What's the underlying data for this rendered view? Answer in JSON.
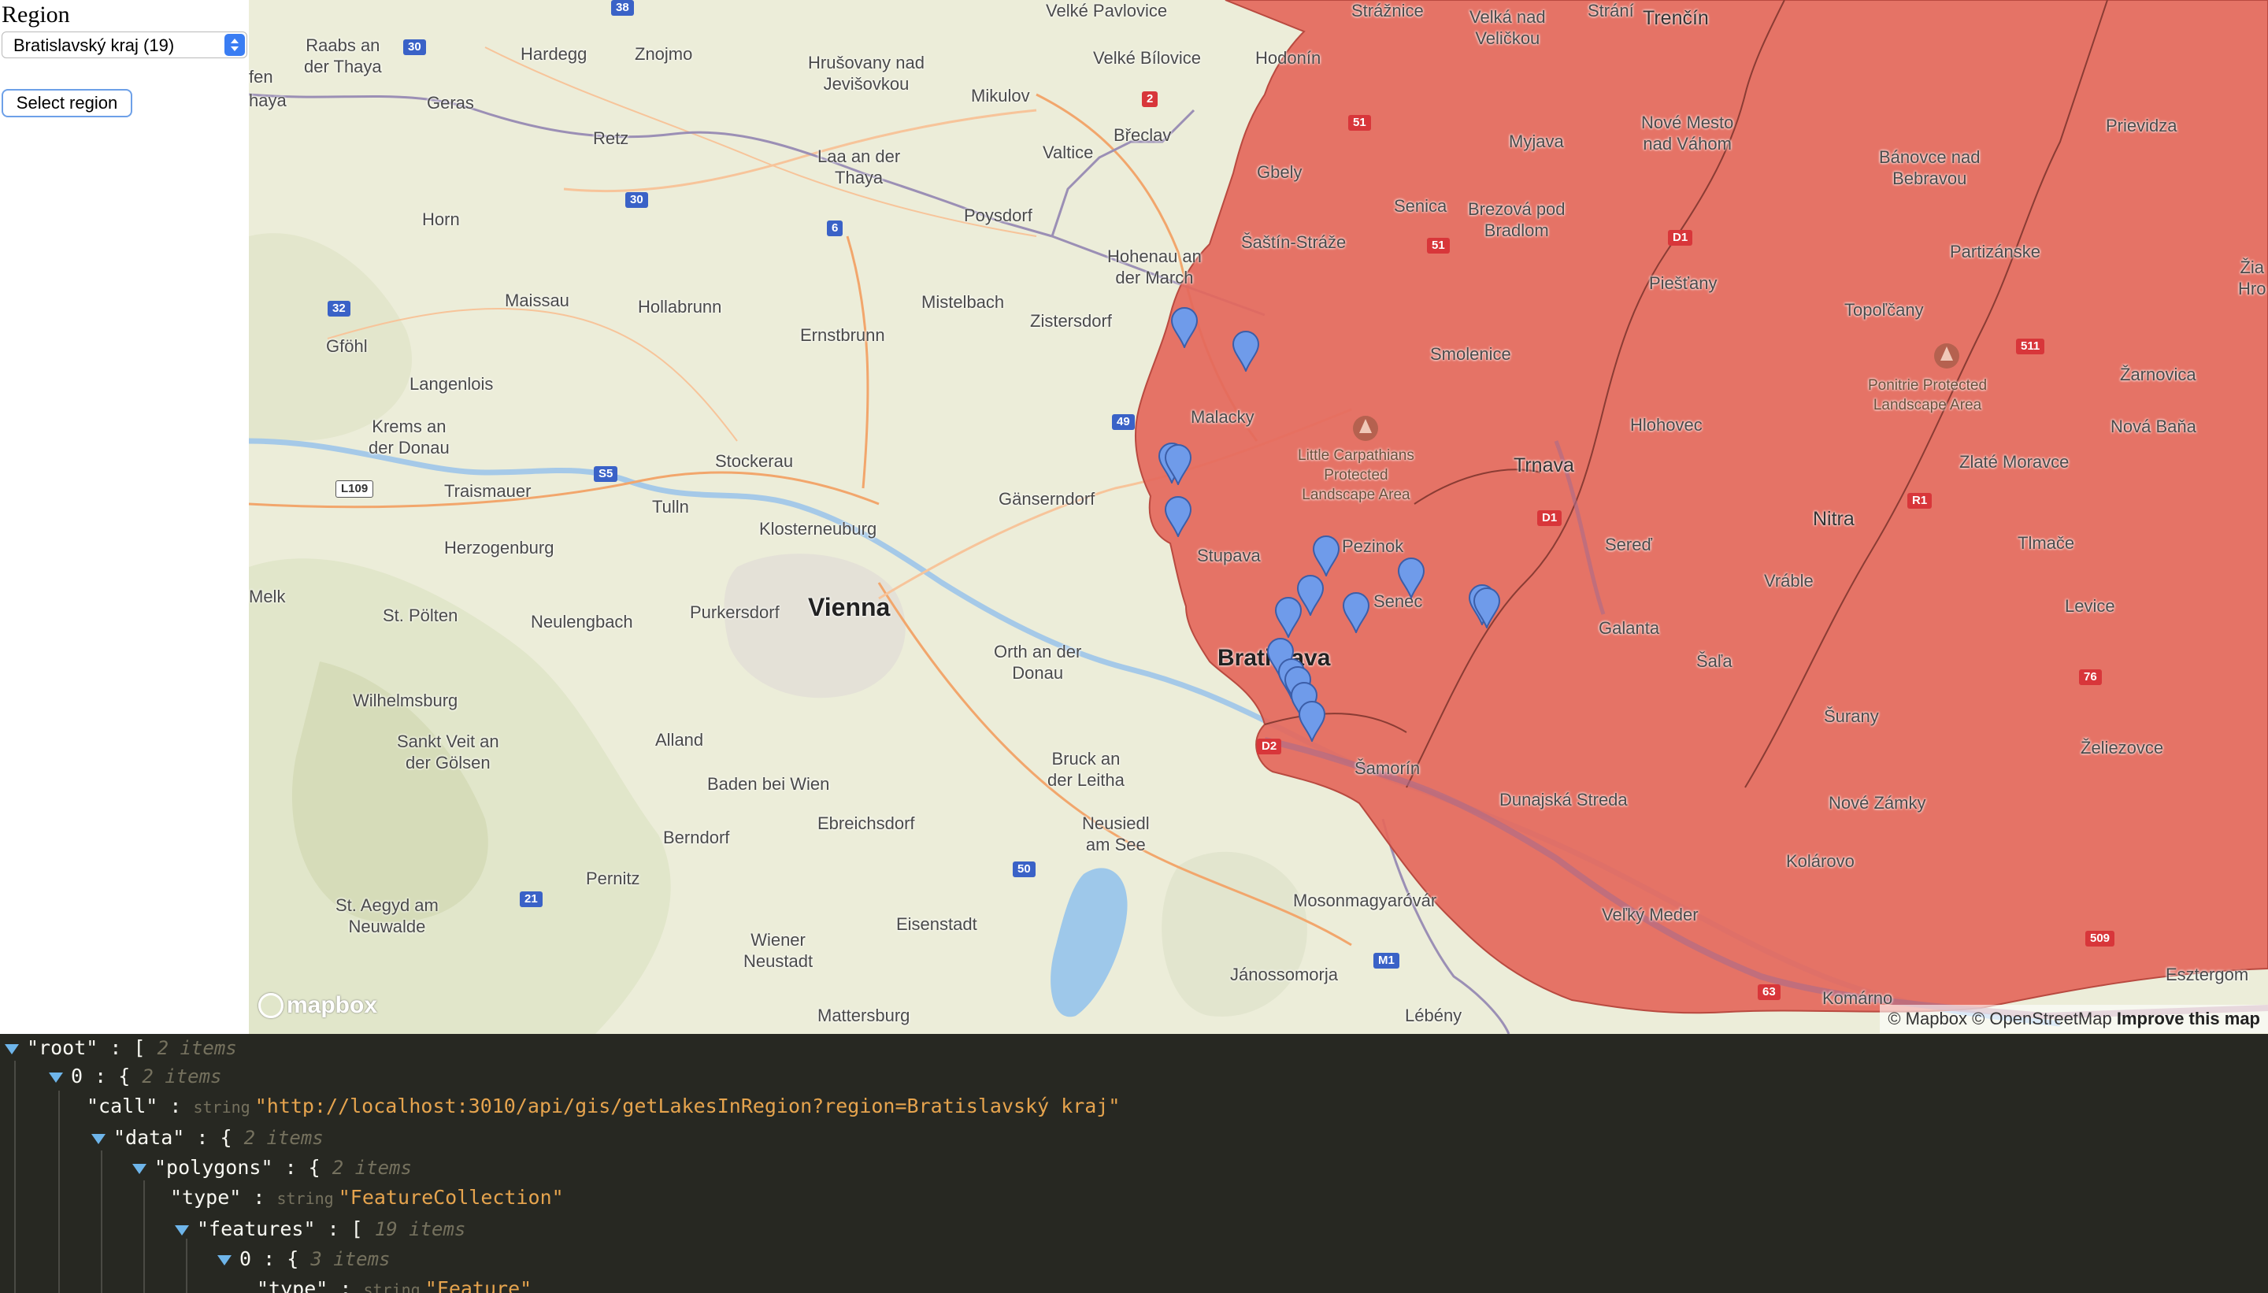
{
  "form": {
    "label": "Region",
    "select_value": "Bratislavský kraj (19)",
    "button": "Select region"
  },
  "map": {
    "labels": {
      "raabs": "Raabs an\nder Thaya",
      "hardegg": "Hardegg",
      "znojmo": "Znojmo",
      "hrusovany": "Hrušovany nad\nJevišovkou",
      "velke_bilovice": "Velké Bílovice",
      "velke_pavlovice": "Velké Pavlovice",
      "hodonin": "Hodonín",
      "straznice": "Strážnice",
      "velka_nad_velickou": "Velká nad\nVeličkou",
      "strani": "Strání",
      "trencin": "Trenčín",
      "fen": "fen",
      "haya": "haya",
      "geras": "Geras",
      "mikulov": "Mikulov",
      "retz": "Retz",
      "laa": "Laa an der\nThaya",
      "valtice": "Valtice",
      "breclav": "Břeclav",
      "myjava": "Myjava",
      "nove_mesto": "Nové Mesto\nnad Váhom",
      "prievidza": "Prievidza",
      "banovce": "Bánovce nad\nBebravou",
      "gbely": "Gbely",
      "senica": "Senica",
      "brezova": "Brezová pod\nBradlom",
      "poysdorf": "Poysdorf",
      "horn": "Horn",
      "sastin": "Šaštín-Stráže",
      "hohenau": "Hohenau an\nder March",
      "piestany": "Piešťany",
      "partizanske": "Partizánske",
      "zia": "Žia\nHro",
      "maissau": "Maissau",
      "hollabrunn": "Hollabrunn",
      "mistelbach": "Mistelbach",
      "zistersdorf": "Zistersdorf",
      "topolcany": "Topoľčany",
      "gfohl": "Gföhl",
      "ernstbrunn": "Ernstbrunn",
      "smolenice": "Smolenice",
      "pontrie": "Ponitrie Protected\nLandscape Area",
      "zarnovica": "Žarnovica",
      "langenlois": "Langenlois",
      "krems": "Krems an\nder Donau",
      "malacky": "Malacky",
      "hlohovec": "Hlohovec",
      "nova_bana": "Nová Baňa",
      "little_carpathians": "Little Carpathians\nProtected\nLandscape Area",
      "stockerau": "Stockerau",
      "trnava": "Trnava",
      "zlate_moravce": "Zlaté Moravce",
      "traismauer": "Traismauer",
      "tulln": "Tulln",
      "ganserndorf": "Gänserndorf",
      "nitra": "Nitra",
      "klosterneuburg": "Klosterneuburg",
      "herzogenburg": "Herzogenburg",
      "stupava": "Stupava",
      "pezinok": "Pezinok",
      "sered": "Sereď",
      "tlmace": "Tlmače",
      "melk": "Melk",
      "vienna": "Vienna",
      "vrable": "Vráble",
      "st_polten": "St. Pölten",
      "neulengbach": "Neulengbach",
      "purkersdorf": "Purkersdorf",
      "senec": "Senec",
      "levice": "Levice",
      "galanta": "Galanta",
      "orth": "Orth an der\nDonau",
      "bratislava": "Bratislava",
      "sala": "Šaľa",
      "wilhelmsburg": "Wilhelmsburg",
      "surany": "Šurany",
      "sankt_veit": "Sankt Veit an\nder Gölsen",
      "alland": "Alland",
      "zeliezovce": "Želiezovce",
      "bruck": "Bruck an\nder Leitha",
      "samorin": "Šamorín",
      "baden": "Baden bei Wien",
      "dunajska": "Dunajská Streda",
      "nove_zamky": "Nové Zámky",
      "ebreichsdorf": "Ebreichsdorf",
      "neusiedl": "Neusiedl\nam See",
      "berndorf": "Berndorf",
      "kolarovo": "Kolárovo",
      "pernitz": "Pernitz",
      "st_aegyd": "St. Aegyd am\nNeuwalde",
      "mosonmagyarovar": "Mosonmagyaróvár",
      "velky_meder": "Veľký Meder",
      "wiener_neustadt": "Wiener\nNeustadt",
      "eisenstadt": "Eisenstadt",
      "janossomorja": "Jánossomorja",
      "esztergom": "Esztergom",
      "komarno": "Komárno",
      "mattersburg": "Mattersburg",
      "lebeny": "Lébény"
    },
    "shields": {
      "r38": "38",
      "r30a": "30",
      "r2": "2",
      "r51a": "51",
      "r30b": "30",
      "r6": "6",
      "r51b": "51",
      "rd1a": "D1",
      "r32": "32",
      "r511": "511",
      "r49": "49",
      "rl109": "L109",
      "rs5": "S5",
      "rd1b": "D1",
      "rr1": "R1",
      "rd2": "D2",
      "r76": "76",
      "r50": "50",
      "r21": "21",
      "rm1": "M1",
      "r509": "509",
      "r63": "63"
    },
    "logo": "mapbox",
    "attribution": {
      "mapbox": "© Mapbox",
      "osm": "© OpenStreetMap",
      "improve": "Improve this map"
    },
    "colors": {
      "region_fill": "#e4685c",
      "marker": "#6f9bea",
      "land": "#ecedd9"
    }
  },
  "json_view": {
    "root_key": "\"root\"",
    "root_count": "2 items",
    "idx0_key": "0",
    "idx0_count": "2 items",
    "call_key": "\"call\"",
    "call_type": "string",
    "call_value": "\"http://localhost:3010/api/gis/getLakesInRegion?region=Bratislavský kraj\"",
    "data_key": "\"data\"",
    "data_count": "2 items",
    "polygons_key": "\"polygons\"",
    "polygons_count": "2 items",
    "type_key": "\"type\"",
    "type_type": "string",
    "type_value": "\"FeatureCollection\"",
    "features_key": "\"features\"",
    "features_count": "19 items",
    "f0_key": "0",
    "f0_count": "3 items",
    "f0_type_key": "\"type\"",
    "f0_type_type": "string",
    "f0_type_value": "\"Feature\""
  }
}
